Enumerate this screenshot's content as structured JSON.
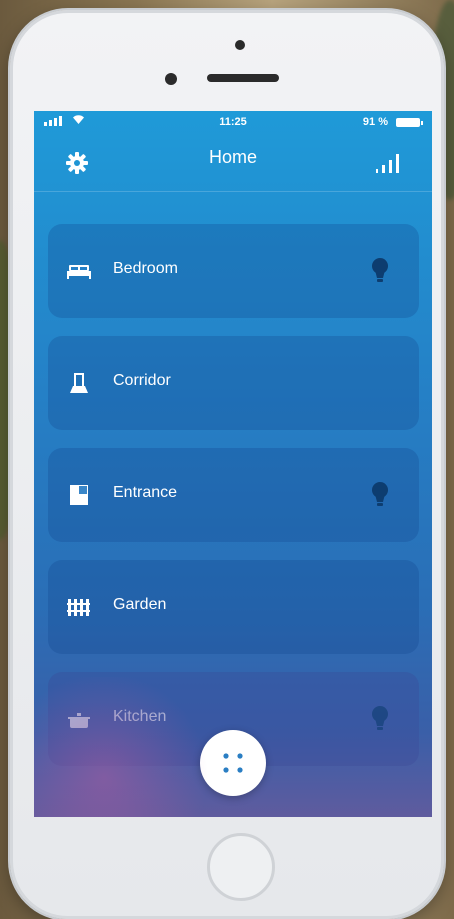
{
  "status": {
    "time": "11:25",
    "battery": "91 %"
  },
  "header": {
    "title": "Home",
    "settings_icon": "gear-icon",
    "stats_icon": "signal-bars-icon"
  },
  "rooms": [
    {
      "label": "Bedroom",
      "icon": "bed-icon",
      "has_bulb": true
    },
    {
      "label": "Corridor",
      "icon": "lamp-icon",
      "has_bulb": false
    },
    {
      "label": "Entrance",
      "icon": "door-icon",
      "has_bulb": true
    },
    {
      "label": "Garden",
      "icon": "fence-icon",
      "has_bulb": false
    },
    {
      "label": "Kitchen",
      "icon": "pot-icon",
      "has_bulb": true
    }
  ],
  "fab": {
    "icon": "dots-grid-icon"
  },
  "colors": {
    "screen_top": "#1f9ad8",
    "screen_bottom": "#5f5b9e",
    "bulb": "#0d3d70"
  }
}
